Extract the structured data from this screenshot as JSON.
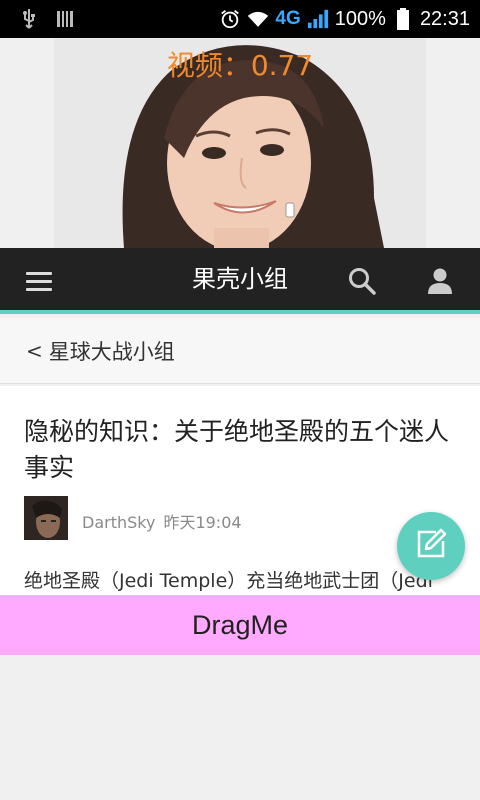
{
  "status_bar": {
    "network": "4G",
    "battery": "100%",
    "time": "22:31"
  },
  "video": {
    "label": "视频：0.77"
  },
  "toolbar": {
    "title": "果壳小组"
  },
  "back": {
    "arrow": "<",
    "label": "星球大战小组"
  },
  "article": {
    "title": "隐秘的知识：关于绝地圣殿的五个迷人事实",
    "author": "DarthSky",
    "time": "昨天19:04",
    "body": "绝地圣殿（Jedi Temple）充当绝地武士团（Jedi"
  },
  "drag": {
    "label": "DragMe"
  },
  "colors": {
    "accent": "#5fd0c0",
    "toolbar_bg": "#222222",
    "video_label": "#f08a2c",
    "drag_bg": "#ffaaff"
  }
}
